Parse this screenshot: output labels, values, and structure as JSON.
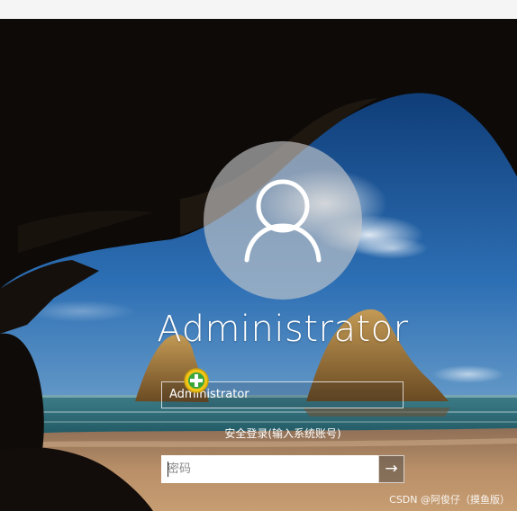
{
  "window": {
    "background_top": "#f5f5f5"
  },
  "login": {
    "avatar_icon": "user-silhouette-icon",
    "user_name": "Administrator",
    "account_field_value": "Administrator",
    "account_badge_icon": "green-plus-shield-icon",
    "secure_login_link": "安全登录(输入系统账号)",
    "password_placeholder": "密码",
    "submit_icon": "arrow-right-icon",
    "submit_glyph": "→"
  },
  "watermark": {
    "text": "CSDN @阿俊仔（摸鱼版）"
  },
  "colors": {
    "sky_blue": "#2b6cb0",
    "sea_teal": "#2f7f8c",
    "sand": "#b08a64",
    "cave_dark": "#0c0907",
    "rock_gold": "#a47a3c"
  }
}
